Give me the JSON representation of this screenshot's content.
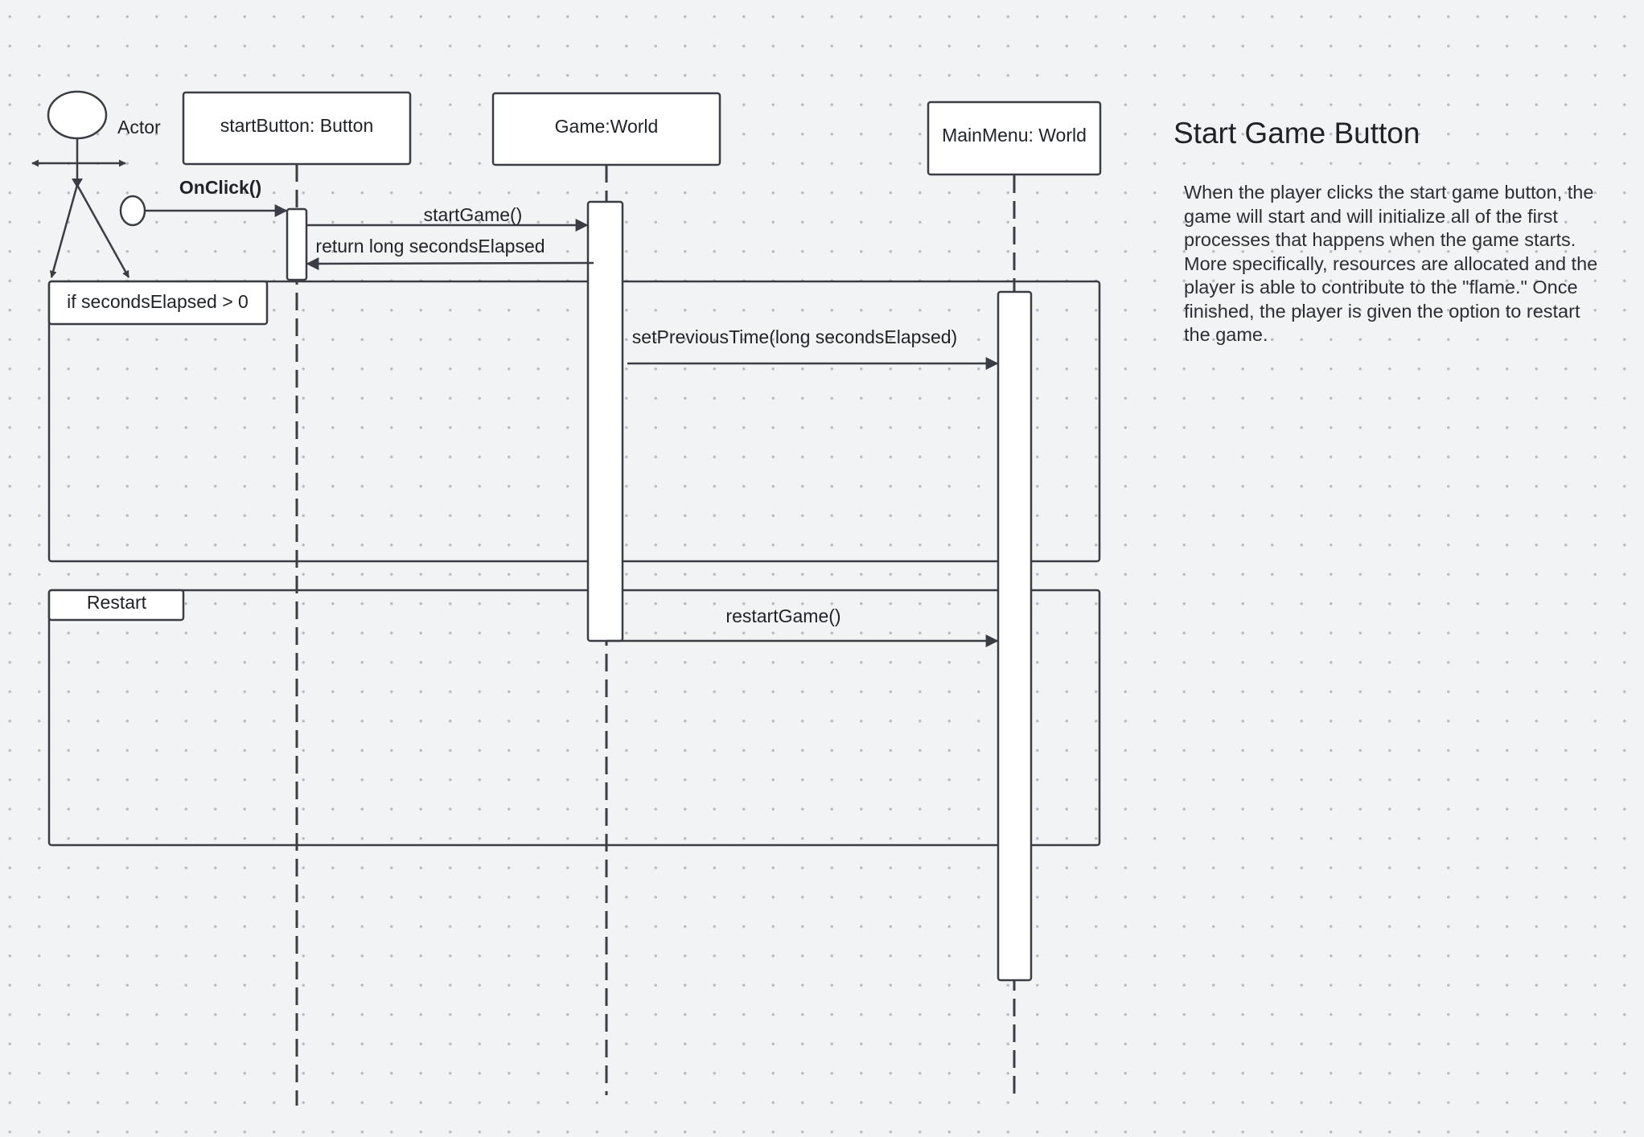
{
  "diagram": {
    "actor": {
      "label": "Actor"
    },
    "lifelines": [
      {
        "label": "startButton: Button"
      },
      {
        "label": "Game:World"
      },
      {
        "label": "MainMenu: World"
      }
    ],
    "messages": [
      {
        "label": "OnClick()"
      },
      {
        "label": "startGame()"
      },
      {
        "label": "return long secondsElapsed"
      },
      {
        "label": "setPreviousTime(long secondsElapsed)"
      },
      {
        "label": "restartGame()"
      }
    ],
    "fragments": [
      {
        "label": "if secondsElapsed > 0"
      },
      {
        "label": "Restart"
      }
    ]
  },
  "side_note": {
    "title": "Start Game Button",
    "description": "When the player clicks the start game button, the game will start and will initialize all of the first processes that happens when the game starts. More specifically, resources are allocated and the player is able to contribute to the \"flame.\" Once finished, the player is given the option to restart the game."
  },
  "colors": {
    "line": "#3a3d44",
    "background": "#f2f3f5",
    "box": "#ffffff"
  }
}
